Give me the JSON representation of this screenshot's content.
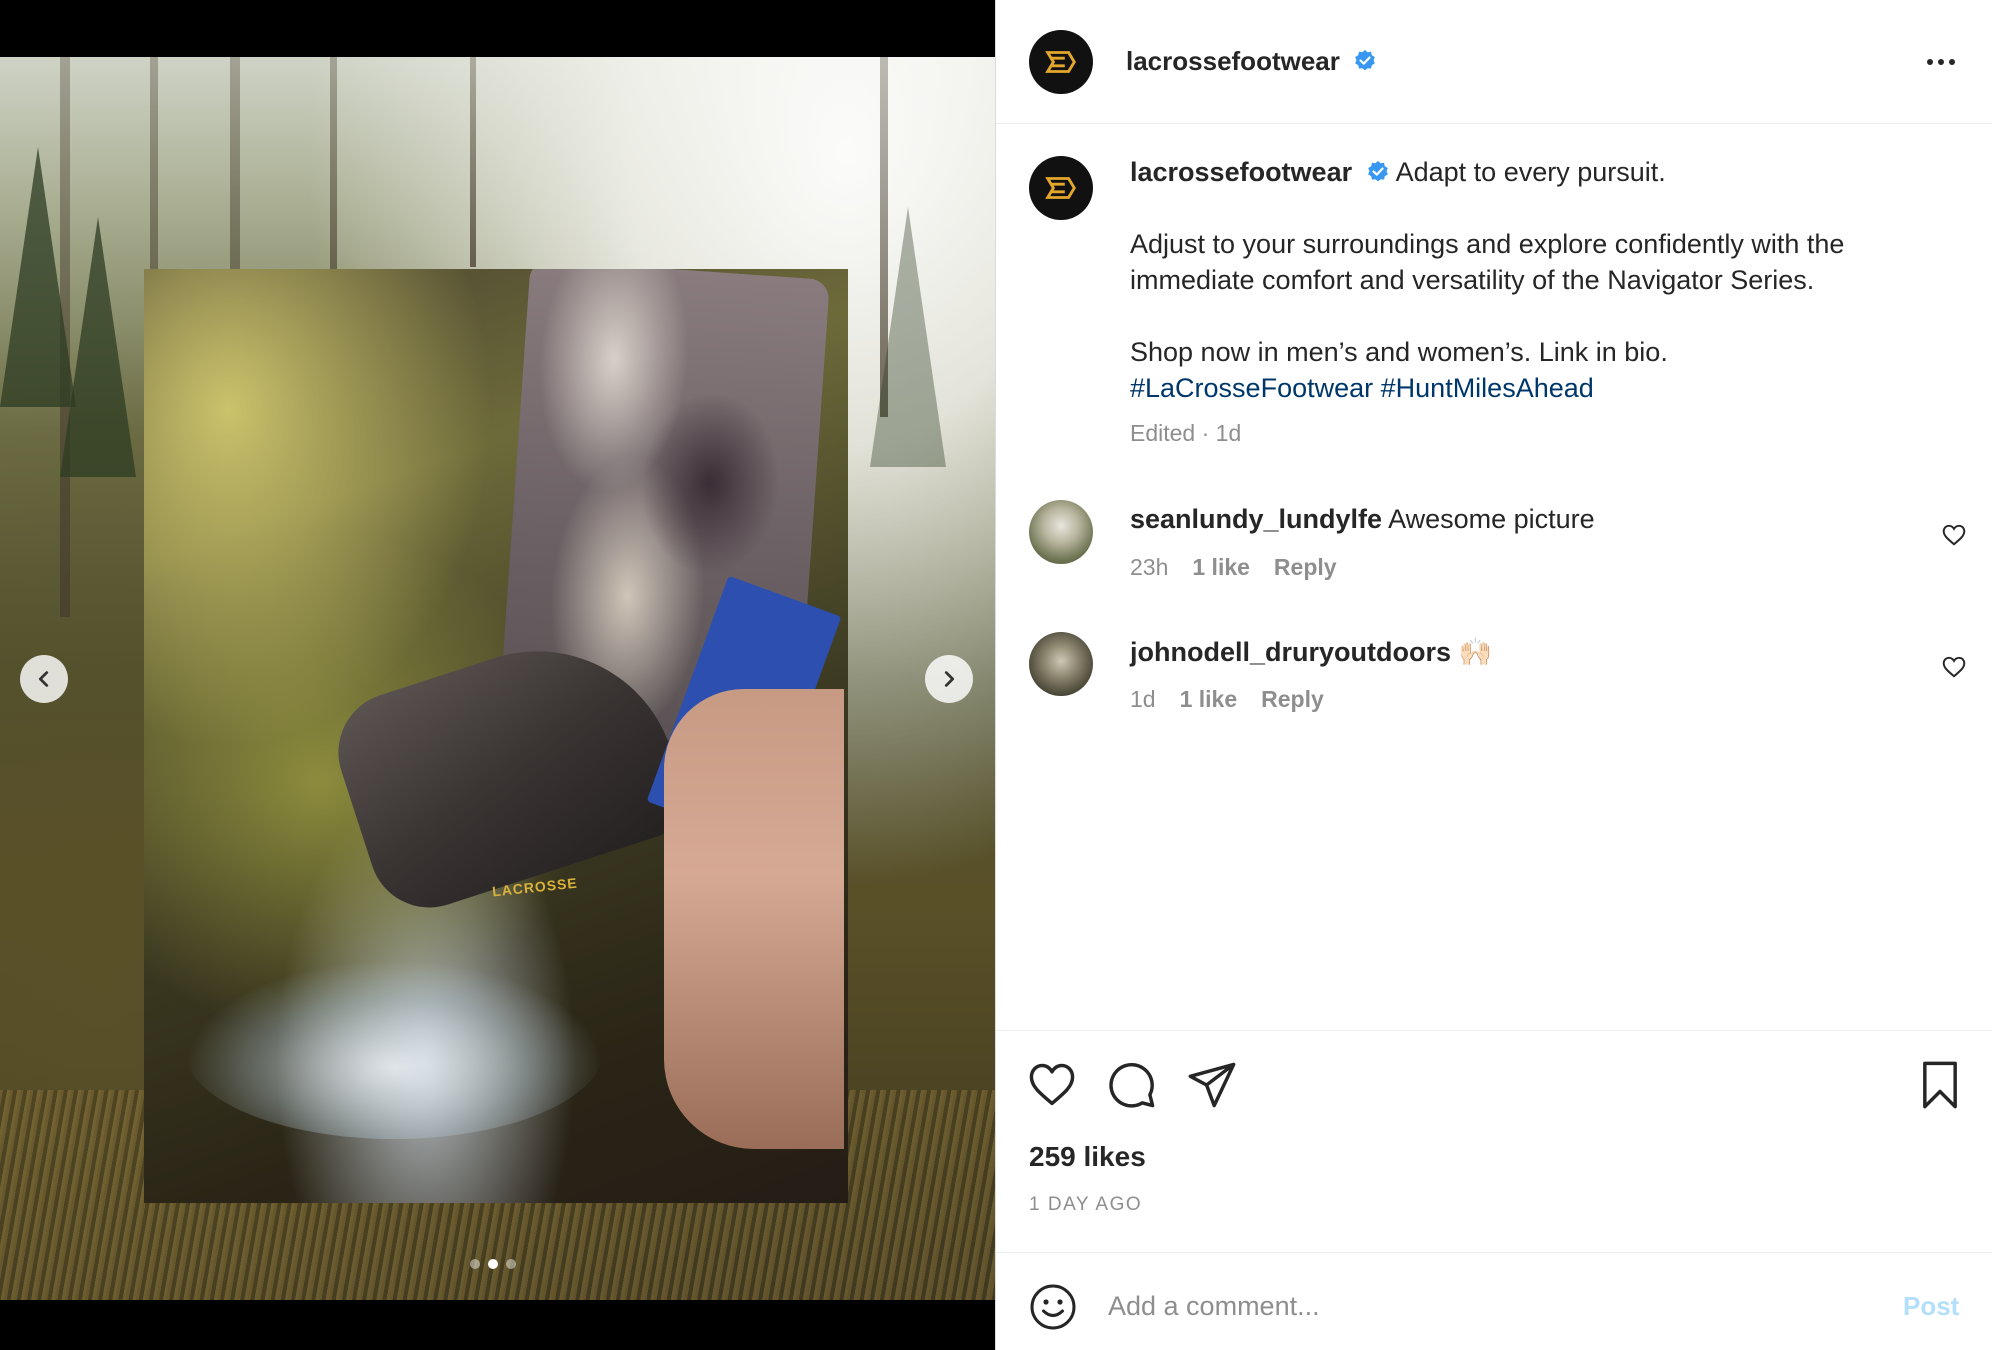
{
  "post": {
    "username": "lacrossefootwear",
    "verified": true,
    "image_brand_text": "LACROSSE",
    "carousel": {
      "total_slides": 3,
      "active_index": 1
    }
  },
  "caption": {
    "username": "lacrossefootwear",
    "line1": "Adapt to every pursuit.",
    "line2": "Adjust to your surroundings and explore confidently with the immediate comfort and versatility of the Navigator Series.",
    "line3": "Shop now in men’s and women’s. Link in bio.",
    "hashtags": [
      "#LaCrosseFootwear",
      "#HuntMilesAhead"
    ],
    "meta": "Edited · 1d"
  },
  "comments": [
    {
      "username": "seanlundy_lundylfe",
      "text": "Awesome picture",
      "time": "23h",
      "likes": "1 like",
      "reply": "Reply"
    },
    {
      "username": "johnodell_druryoutdoors",
      "text": "🙌🏻",
      "time": "1d",
      "likes": "1 like",
      "reply": "Reply"
    }
  ],
  "stats": {
    "likes": "259 likes",
    "timestamp": "1 day ago"
  },
  "comment_box": {
    "placeholder": "Add a comment...",
    "post_label": "Post"
  },
  "colors": {
    "brand_gold": "#e3a82b",
    "link_blue": "#00376b",
    "verified_blue": "#3897f0",
    "post_disabled": "#b2dffc",
    "muted_text": "#8e8e8e"
  },
  "icons": {
    "carousel_prev": "chevron-left-icon",
    "carousel_next": "chevron-right-icon",
    "more": "more-horizontal-icon",
    "like": "heart-icon",
    "comment": "comment-bubble-icon",
    "share": "paper-plane-icon",
    "save": "bookmark-icon",
    "emoji": "smiley-icon",
    "verified": "verified-badge-icon"
  }
}
